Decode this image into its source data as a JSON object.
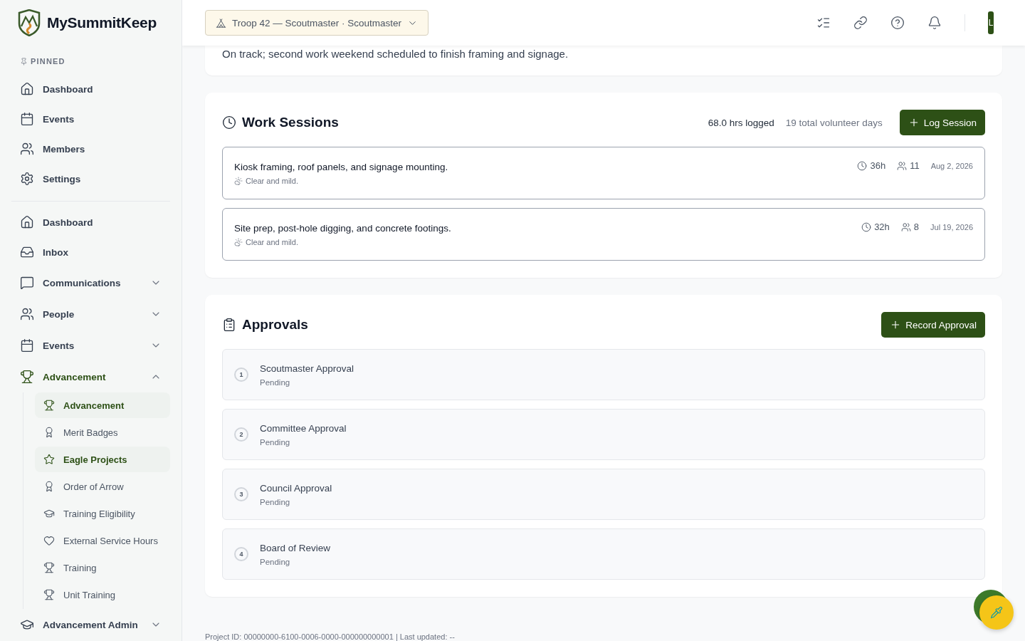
{
  "app": {
    "name": "MySummitKeep"
  },
  "sidebar": {
    "pinned_heading": "PINNED",
    "pinned": [
      {
        "label": "Dashboard"
      },
      {
        "label": "Events"
      },
      {
        "label": "Members"
      },
      {
        "label": "Settings"
      }
    ],
    "nav": [
      {
        "label": "Dashboard",
        "selected": false
      },
      {
        "label": "Inbox",
        "selected": false
      },
      {
        "label": "Communications",
        "selected": false,
        "expanded": false
      },
      {
        "label": "People",
        "selected": false,
        "expanded": false
      },
      {
        "label": "Events",
        "selected": false,
        "expanded": false
      },
      {
        "label": "Advancement",
        "selected": true,
        "expanded": true,
        "children": [
          {
            "label": "Advancement",
            "selected": true
          },
          {
            "label": "Merit Badges",
            "selected": false
          },
          {
            "label": "Eagle Projects",
            "selected": true
          },
          {
            "label": "Order of Arrow",
            "selected": false
          },
          {
            "label": "Training Eligibility",
            "selected": false
          },
          {
            "label": "External Service Hours",
            "selected": false
          },
          {
            "label": "Training",
            "selected": false
          },
          {
            "label": "Unit Training",
            "selected": false
          }
        ]
      },
      {
        "label": "Advancement Admin",
        "selected": false,
        "expanded": false
      }
    ]
  },
  "header": {
    "unit_selector": "Troop 42 — Scoutmaster · Scoutmaster",
    "avatar_initial": "L"
  },
  "summary_note": "On track; second work weekend scheduled to finish framing and signage.",
  "work_sessions": {
    "title": "Work Sessions",
    "hours_logged": "68.0 hrs logged",
    "volunteer_days": "19 total volunteer days",
    "button": "Log Session",
    "sessions": [
      {
        "description": "Kiosk framing, roof panels, and signage mounting.",
        "weather": "Clear and mild.",
        "hours": "36h",
        "volunteers": "11",
        "date": "Aug 2, 2026"
      },
      {
        "description": "Site prep, post-hole digging, and concrete footings.",
        "weather": "Clear and mild.",
        "hours": "32h",
        "volunteers": "8",
        "date": "Jul 19, 2026"
      }
    ]
  },
  "approvals": {
    "title": "Approvals",
    "button": "Record Approval",
    "steps": [
      {
        "number": "1",
        "name": "Scoutmaster Approval",
        "status": "Pending"
      },
      {
        "number": "2",
        "name": "Committee Approval",
        "status": "Pending"
      },
      {
        "number": "3",
        "name": "Council Approval",
        "status": "Pending"
      },
      {
        "number": "4",
        "name": "Board of Review",
        "status": "Pending"
      }
    ]
  },
  "footer": "Project ID: 00000000-6100-0006-0000-000000000001 | Last updated: --"
}
